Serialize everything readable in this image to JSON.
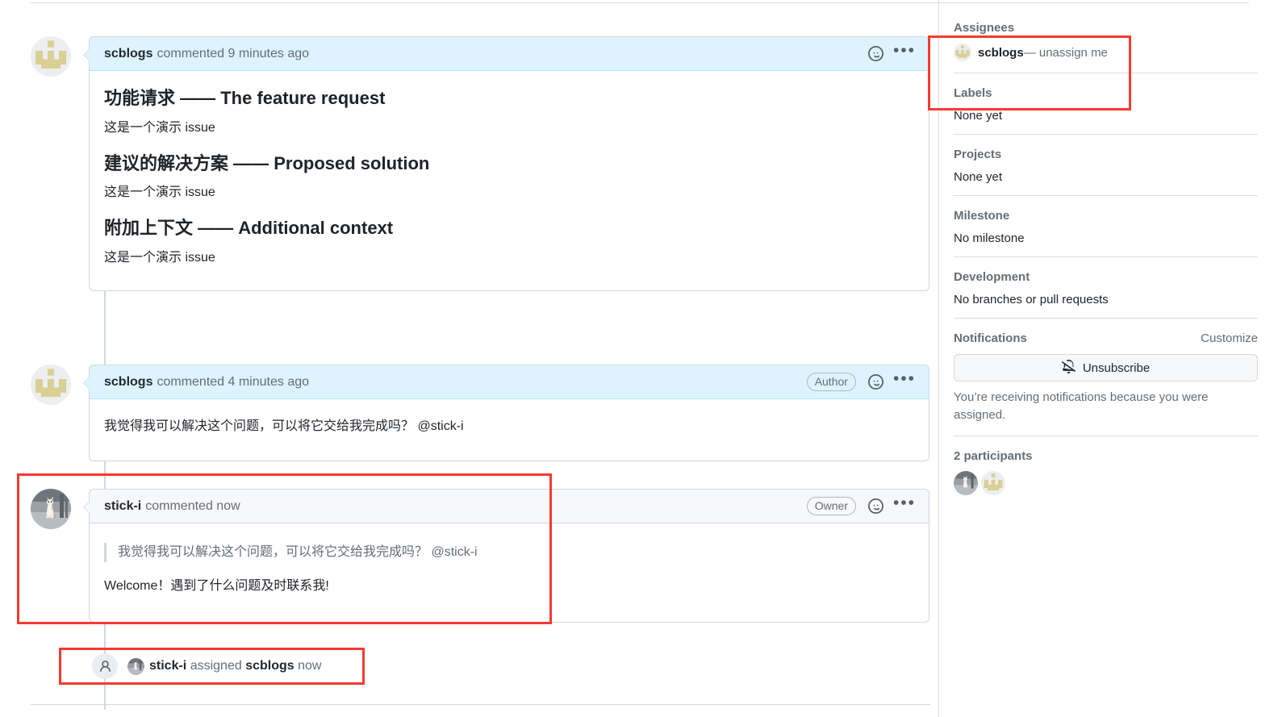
{
  "comments": [
    {
      "author": "scblogs",
      "meta": "commented 9 minutes ago",
      "badge": null,
      "reaction_icon": "smiley-icon",
      "menu_icon": "kebab-horizontal-icon",
      "blocks": [
        {
          "type": "h3",
          "text": "功能请求 —— The feature request"
        },
        {
          "type": "p",
          "text": "这是一个演示 issue"
        },
        {
          "type": "h3",
          "text": "建议的解决方案 —— Proposed solution"
        },
        {
          "type": "p",
          "text": "这是一个演示 issue"
        },
        {
          "type": "h3",
          "text": "附加上下文 —— Additional context"
        },
        {
          "type": "p",
          "text": "这是一个演示 issue"
        }
      ]
    },
    {
      "author": "scblogs",
      "meta": "commented 4 minutes ago",
      "badge": "Author",
      "reaction_icon": "smiley-icon",
      "menu_icon": "kebab-horizontal-icon",
      "blocks": [
        {
          "type": "p",
          "text": "我觉得我可以解决这个问题，可以将它交给我完成吗？ @stick-i"
        }
      ]
    },
    {
      "author": "stick-i",
      "meta": "commented now",
      "badge": "Owner",
      "reaction_icon": "smiley-icon",
      "menu_icon": "kebab-horizontal-icon",
      "blocks": [
        {
          "type": "quote",
          "text": "我觉得我可以解决这个问题，可以将它交给我完成吗？ @stick-i"
        },
        {
          "type": "p",
          "text": "Welcome！遇到了什么问题及时联系我!"
        }
      ]
    }
  ],
  "timeline_event": {
    "icon": "person-icon",
    "actor": "stick-i",
    "verb": "assigned",
    "target": "scblogs",
    "time": "now"
  },
  "sidebar": {
    "assignees": {
      "title": "Assignees",
      "user": "scblogs",
      "action": "— unassign me"
    },
    "labels": {
      "title": "Labels",
      "value": "None yet"
    },
    "projects": {
      "title": "Projects",
      "value": "None yet"
    },
    "milestone": {
      "title": "Milestone",
      "value": "No milestone"
    },
    "development": {
      "title": "Development",
      "value": "No branches or pull requests"
    },
    "notifications": {
      "title": "Notifications",
      "customize": "Customize",
      "button_label": "Unsubscribe",
      "button_icon": "bell-slash-icon",
      "note": "You’re receiving notifications because you were assigned."
    },
    "participants": {
      "title": "2 participants"
    }
  },
  "colors": {
    "author_header_bg": "#ddf4ff",
    "author_header_border": "#b6e3ff",
    "header_bg": "#f6f8fa",
    "header_border": "#d0d7de",
    "highlight": "#f53b30",
    "text": "#1f2328",
    "muted": "#656d76"
  }
}
